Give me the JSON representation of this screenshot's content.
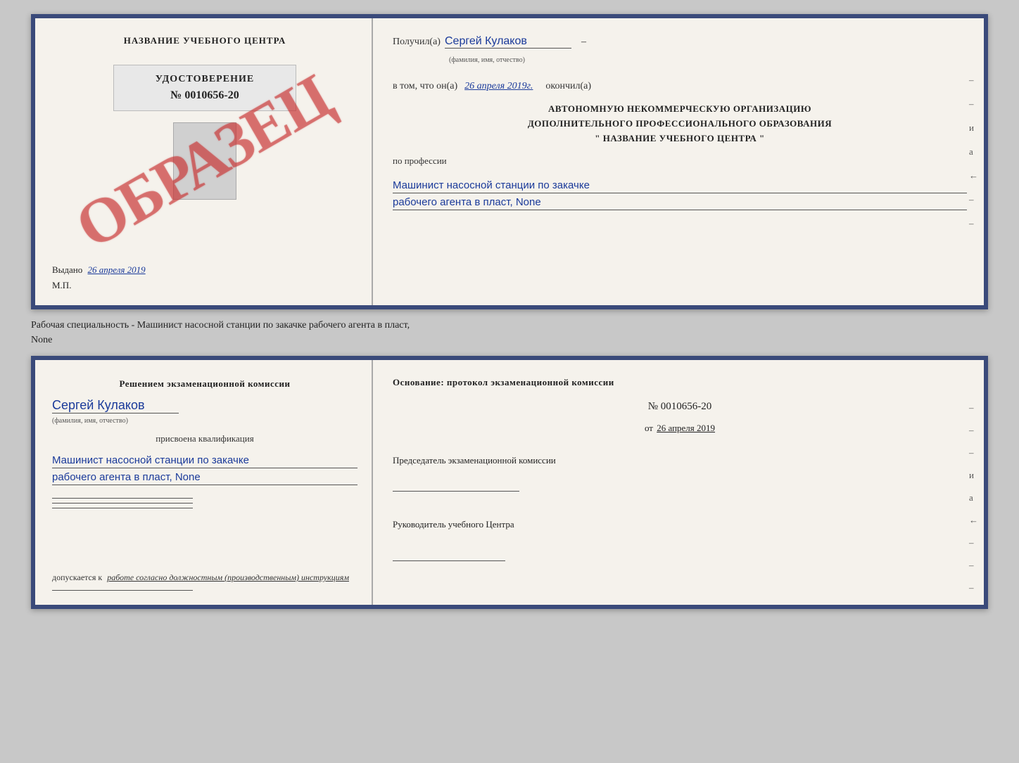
{
  "top_doc": {
    "left": {
      "center_title": "НАЗВАНИЕ УЧЕБНОГО ЦЕНТРА",
      "obrazets": "ОБРАЗЕЦ",
      "udostoverenie_title": "УДОСТОВЕРЕНИЕ",
      "udostoverenie_number": "№ 0010656-20",
      "vydano_label": "Выдано",
      "vydano_date": "26 апреля 2019",
      "mp_label": "М.П."
    },
    "right": {
      "poluchil_label": "Получил(а)",
      "poluchil_value": "Сергей Кулаков",
      "familiya_label": "(фамилия, имя, отчество)",
      "v_tom_label": "в том, что он(а)",
      "v_tom_value": "26 апреля 2019г.",
      "okonchil_label": "окончил(а)",
      "block_line1": "АВТОНОМНУЮ НЕКОММЕРЧЕСКУЮ ОРГАНИЗАЦИЮ",
      "block_line2": "ДОПОЛНИТЕЛЬНОГО ПРОФЕССИОНАЛЬНОГО ОБРАЗОВАНИЯ",
      "block_line3": "\" НАЗВАНИЕ УЧЕБНОГО ЦЕНТРА \"",
      "po_professii_label": "по профессии",
      "profession_line1": "Машинист насосной станции по закачке",
      "profession_line2": "рабочего агента в пласт, None",
      "right_marks": [
        "-",
        "-",
        "и",
        "а",
        "←",
        "-",
        "-"
      ]
    }
  },
  "separator": {
    "text_line1": "Рабочая специальность - Машинист насосной станции по закачке рабочего агента в пласт,",
    "text_line2": "None"
  },
  "bottom_doc": {
    "left": {
      "resheniem_title": "Решением экзаменационной комиссии",
      "name_value": "Сергей Кулаков",
      "familiya_label": "(фамилия, имя, отчество)",
      "prisvoena_label": "присвоена квалификация",
      "qualification_line1": "Машинист насосной станции по закачке",
      "qualification_line2": "рабочего агента в пласт, None",
      "dopuskaetsya_label": "допускается к",
      "dopuskaetsya_value": "работе согласно должностным (производственным) инструкциям"
    },
    "right": {
      "osnovaniye_label": "Основание: протокол экзаменационной комиссии",
      "protocol_number": "№ 0010656-20",
      "ot_label": "от",
      "ot_date": "26 апреля 2019",
      "predsedatel_label": "Председатель экзаменационной комиссии",
      "rukovoditel_label": "Руководитель учебного Центра",
      "right_marks": [
        "-",
        "-",
        "-",
        "и",
        "а",
        "←",
        "-",
        "-",
        "-"
      ]
    }
  }
}
